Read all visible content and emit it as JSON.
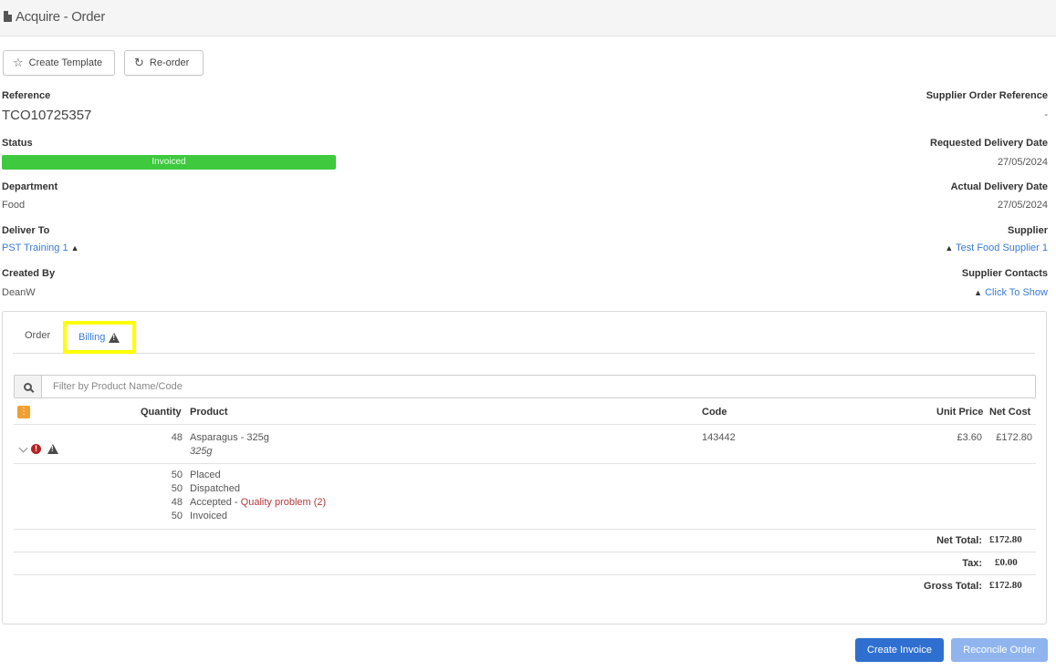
{
  "header": {
    "title": "Acquire - Order",
    "icon": "document-icon"
  },
  "toolbar": {
    "create_template": {
      "label": "Create Template",
      "icon": "star-icon"
    },
    "reorder": {
      "label": "Re-order",
      "icon": "redo-icon"
    }
  },
  "left_fields": {
    "reference_label": "Reference",
    "reference_value": "TCO10725357",
    "status_label": "Status",
    "status_value": "Invoiced",
    "department_label": "Department",
    "department_value": "Food",
    "deliver_to_label": "Deliver To",
    "deliver_to_value": "PST Training 1",
    "created_by_label": "Created By",
    "created_by_value": "DeanW"
  },
  "right_fields": {
    "supplier_ref_label": "Supplier Order Reference",
    "supplier_ref_value": "-",
    "requested_label": "Requested Delivery Date",
    "requested_value": "27/05/2024",
    "actual_label": "Actual Delivery Date",
    "actual_value": "27/05/2024",
    "supplier_label": "Supplier",
    "supplier_value": "Test Food Supplier 1",
    "contacts_label": "Supplier Contacts",
    "contacts_value": "Click To Show"
  },
  "tabs": {
    "order": "Order",
    "billing": "Billing"
  },
  "search": {
    "placeholder": "Filter by Product Name/Code"
  },
  "table": {
    "headers": {
      "quantity": "Quantity",
      "product": "Product",
      "code": "Code",
      "unit_price": "Unit Price",
      "net_cost": "Net Cost"
    },
    "row": {
      "quantity": "48",
      "product": "Asparagus - 325g",
      "size": "325g",
      "code": "143442",
      "unit_price": "£3.60",
      "net_cost": "£172.80"
    },
    "breakdown": [
      {
        "qty": "50",
        "text": "Placed"
      },
      {
        "qty": "50",
        "text": "Dispatched"
      },
      {
        "qty": "48",
        "text": "Accepted",
        "sep": " - ",
        "note": "Quality problem (2)"
      },
      {
        "qty": "50",
        "text": "Invoiced"
      }
    ]
  },
  "totals": {
    "net_label": "Net Total:",
    "net_value": "£172.80",
    "tax_label": "Tax:",
    "tax_value": "£0.00",
    "gross_label": "Gross Total:",
    "gross_value": "£172.80"
  },
  "actions": {
    "create_invoice": "Create Invoice",
    "reconcile": "Reconcile Order"
  },
  "colors": {
    "status_green": "#3ec93e",
    "primary": "#2f6fd0",
    "primary_disabled": "#8fb4ee",
    "highlight": "#ffff00",
    "link": "#3a7bd5"
  }
}
